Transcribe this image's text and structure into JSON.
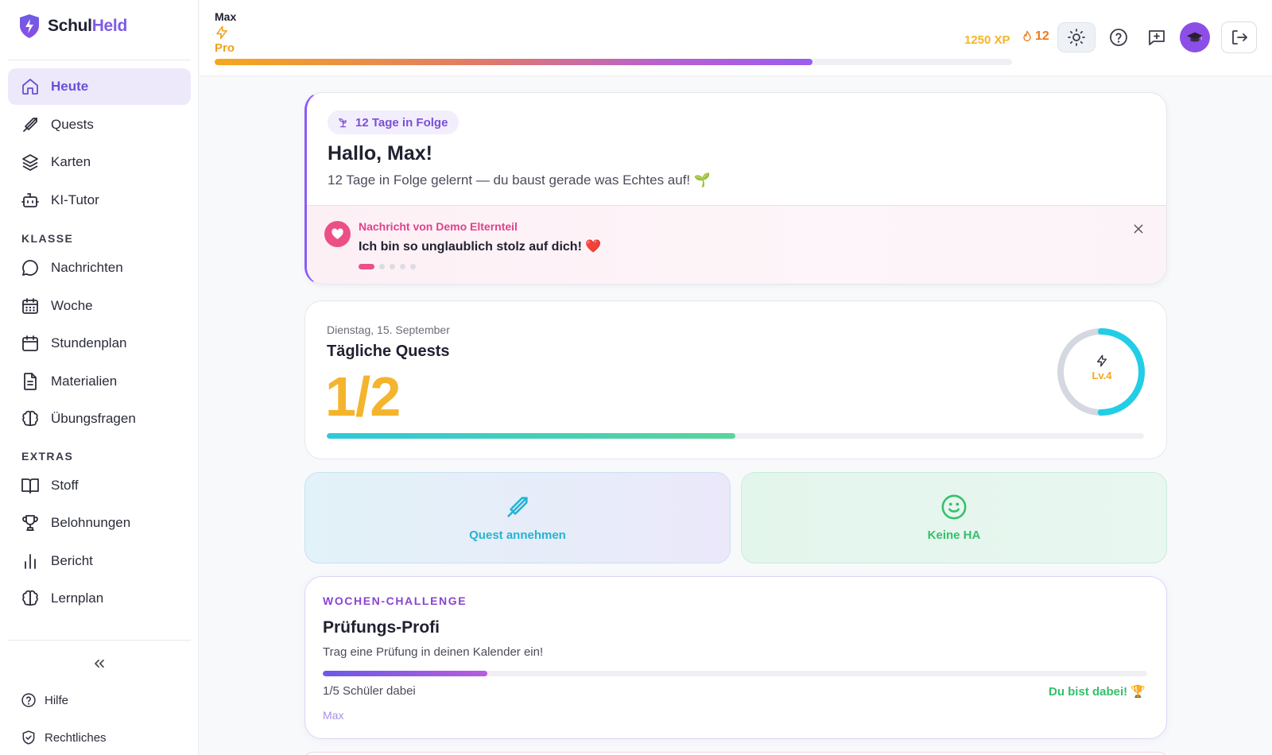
{
  "app": {
    "name_part1": "Schul",
    "name_part2": "Held"
  },
  "sidebar": {
    "items": [
      {
        "label": "Heute",
        "icon": "home-icon",
        "active": true
      },
      {
        "label": "Quests",
        "icon": "sword-icon"
      },
      {
        "label": "Karten",
        "icon": "layers-icon"
      },
      {
        "label": "KI-Tutor",
        "icon": "bot-icon"
      }
    ],
    "section_klasse": "KLASSE",
    "klasse_items": [
      {
        "label": "Nachrichten",
        "icon": "chat-icon"
      },
      {
        "label": "Woche",
        "icon": "calendar-grid-icon"
      },
      {
        "label": "Stundenplan",
        "icon": "calendar-icon"
      },
      {
        "label": "Materialien",
        "icon": "document-icon"
      },
      {
        "label": "Übungsfragen",
        "icon": "brain-icon"
      }
    ],
    "section_extras": "EXTRAS",
    "extras_items": [
      {
        "label": "Stoff",
        "icon": "book-icon"
      },
      {
        "label": "Belohnungen",
        "icon": "trophy-icon"
      },
      {
        "label": "Bericht",
        "icon": "bar-chart-icon"
      },
      {
        "label": "Lernplan",
        "icon": "brain-icon"
      }
    ],
    "footer": {
      "help": "Hilfe",
      "legal": "Rechtliches"
    }
  },
  "topbar": {
    "user_name": "Max",
    "plan": "Pro",
    "xp_progress": 0.75,
    "xp": "1250 XP",
    "streak": "12"
  },
  "hello": {
    "streak_chip": "12 Tage in Folge",
    "title": "Hallo, Max!",
    "subtitle": "12 Tage in Folge gelernt — du baust gerade was Echtes auf! 🌱",
    "message_from": "Nachricht von Demo Elternteil",
    "message_text": "Ich bin so unglaublich stolz auf dich! ❤️",
    "message_count": 5,
    "message_index": 0
  },
  "quests": {
    "date": "Dienstag, 15. September",
    "title": "Tägliche Quests",
    "count": "1/2",
    "progress": 0.5,
    "level": "Lv.4",
    "level_progress": 0.5
  },
  "tiles": {
    "quest": "Quest annehmen",
    "homework": "Keine HA"
  },
  "challenge": {
    "kicker": "WOCHEN-CHALLENGE",
    "title": "Prüfungs-Profi",
    "description": "Trag eine Prüfung in deinen Kalender ein!",
    "progress": 0.2,
    "count": "1/5 Schüler dabei",
    "status": "Du bist dabei! 🏆",
    "member": "Max"
  },
  "colors": {
    "accent": "#7c5ce6",
    "gold": "#f4b42c",
    "pink": "#ec4f86",
    "green": "#34c06a",
    "cyan": "#24b4d0"
  }
}
